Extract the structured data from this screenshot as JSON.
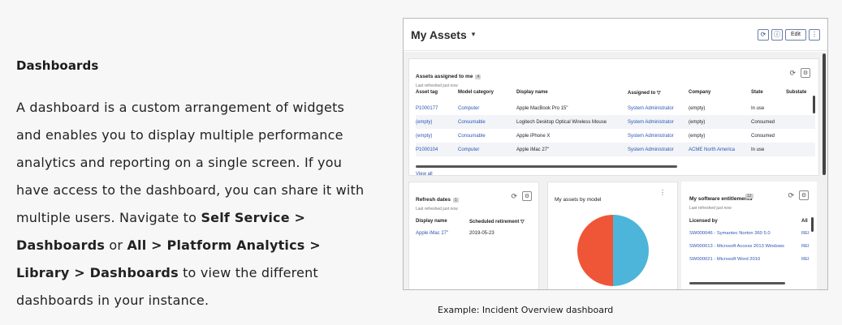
{
  "doc": {
    "heading": "Dashboards",
    "p1": "A dashboard is a custom arrangement of widgets and enables you to display multiple performance analytics and reporting on a single screen. If you have access to the dashboard, you can share it with multiple users. Navigate to ",
    "path1": "Self Service > Dashboards",
    "or": " or ",
    "path2": "All > Platform Analytics > Library > Dashboards",
    "p2": " to view the different dashboards in your instance."
  },
  "screenshot": {
    "title": "My Assets",
    "edit_label": "Edit",
    "assets_card": {
      "title": "Assets assigned to me",
      "count": "4",
      "subtitle": "Last refreshed just now",
      "columns": [
        "Asset tag",
        "Model category",
        "Display name",
        "Assigned to ▽",
        "Company",
        "State",
        "Substate"
      ],
      "rows": [
        [
          "P1000177",
          "Computer",
          "Apple MacBook Pro 15\"",
          "System Administrator",
          "(empty)",
          "In use",
          ""
        ],
        [
          "(empty)",
          "Consumable",
          "Logitech Desktop Optical Wireless Mouse",
          "System Administrator",
          "(empty)",
          "Consumed",
          ""
        ],
        [
          "(empty)",
          "Consumable",
          "Apple iPhone X",
          "System Administrator",
          "(empty)",
          "Consumed",
          ""
        ],
        [
          "P1000104",
          "Computer",
          "Apple iMac 27\"",
          "System Administrator",
          "ACME North America",
          "In use",
          ""
        ]
      ],
      "view_all": "View all"
    },
    "retire_card": {
      "title": "Refresh dates",
      "count": "1",
      "subtitle": "Last refreshed just now",
      "columns": [
        "Display name",
        "Scheduled retirement ▽"
      ],
      "rows": [
        [
          "Apple iMac 27\"",
          "2019-05-23"
        ]
      ]
    },
    "model_card": {
      "title": "My assets by model",
      "menu": "⋮"
    },
    "software_card": {
      "title": "My software entitlements",
      "count": "12",
      "subtitle": "Last refreshed just now",
      "columns": [
        "Licensed by",
        "All"
      ],
      "rows": [
        [
          "SW000046 - Symantec Norton 360 5.0",
          "REI"
        ],
        [
          "SW000013 - Microsoft Access 2013 Windows",
          "REI"
        ],
        [
          "SW000021 - Microsoft Word 2010",
          "REI"
        ]
      ]
    }
  },
  "chart_data": {
    "type": "pie",
    "title": "My assets by model",
    "values": [
      50,
      50
    ],
    "colors": [
      "#4cb5d9",
      "#ef5637"
    ]
  },
  "caption": "Example: Incident Overview dashboard"
}
